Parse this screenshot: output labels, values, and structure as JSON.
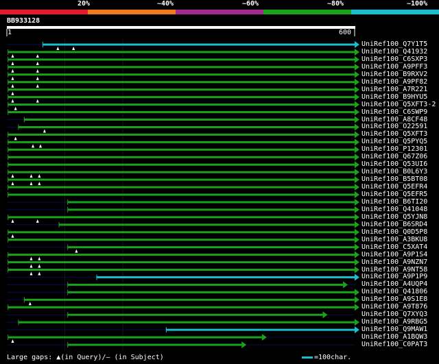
{
  "scale": {
    "segments": [
      {
        "label": "20%",
        "color": "#e8192a"
      },
      {
        "label": "~40%",
        "color": "#f07a1e"
      },
      {
        "label": "~60%",
        "color": "#a12b8e"
      },
      {
        "label": "~80%",
        "color": "#1aa31a"
      },
      {
        "label": "~100%",
        "color": "#19bfcf"
      }
    ]
  },
  "query": {
    "id": "BB933128",
    "start": "1",
    "end": "600",
    "length": 600
  },
  "legend": {
    "gaps": "Large gaps: ▲(in Query)/– (in Subject)",
    "scale": "=100char."
  },
  "colors": {
    "green": "#1aa31a",
    "cyan": "#19bfcf",
    "dim": "#0a0a50",
    "background": "#000000"
  },
  "hits": [
    {
      "id": "UniRef100_Q7Y1T5",
      "color": "cyan",
      "start": 62,
      "end": 600,
      "marks": [
        88,
        115
      ]
    },
    {
      "id": "UniRef100_Q41932",
      "color": "green",
      "start": 2,
      "end": 600,
      "marks": [
        10,
        53
      ]
    },
    {
      "id": "UniRef100_C6SXP3",
      "color": "green",
      "start": 2,
      "end": 600,
      "marks": [
        10,
        53
      ]
    },
    {
      "id": "UniRef100_A9PFF3",
      "color": "green",
      "start": 2,
      "end": 600,
      "marks": [
        10,
        53
      ]
    },
    {
      "id": "UniRef100_B9RXV2",
      "color": "green",
      "start": 2,
      "end": 600,
      "marks": [
        10,
        53
      ]
    },
    {
      "id": "UniRef100_A9PF82",
      "color": "green",
      "start": 2,
      "end": 600,
      "marks": [
        10,
        53
      ]
    },
    {
      "id": "UniRef100_A7R221",
      "color": "green",
      "start": 2,
      "end": 600,
      "marks": [
        10
      ]
    },
    {
      "id": "UniRef100_B9HYU5",
      "color": "green",
      "start": 2,
      "end": 600,
      "marks": [
        10,
        53
      ]
    },
    {
      "id": "UniRef100_Q5XFT3-2",
      "color": "green",
      "start": 2,
      "end": 600,
      "marks": [
        15
      ]
    },
    {
      "id": "UniRef100_C6SWP9",
      "color": "green",
      "start": 2,
      "end": 600,
      "marks": []
    },
    {
      "id": "UniRef100_A8CF48",
      "color": "green",
      "start": 30,
      "end": 600,
      "marks": []
    },
    {
      "id": "UniRef100_O22591",
      "color": "green",
      "start": 20,
      "end": 600,
      "marks": [
        65
      ]
    },
    {
      "id": "UniRef100_Q5XFT3",
      "color": "green",
      "start": 2,
      "end": 600,
      "marks": [
        15
      ]
    },
    {
      "id": "UniRef100_Q5PYQ5",
      "color": "green",
      "start": 2,
      "end": 600,
      "marks": [
        45,
        58
      ]
    },
    {
      "id": "UniRef100_P12301",
      "color": "green",
      "start": 2,
      "end": 600,
      "marks": []
    },
    {
      "id": "UniRef100_Q67Z06",
      "color": "green",
      "start": 2,
      "end": 600,
      "marks": []
    },
    {
      "id": "UniRef100_Q53UI6",
      "color": "green",
      "start": 2,
      "end": 600,
      "marks": []
    },
    {
      "id": "UniRef100_B0L6Y3",
      "color": "green",
      "start": 2,
      "end": 600,
      "marks": [
        10,
        42,
        56
      ]
    },
    {
      "id": "UniRef100_B5BT08",
      "color": "green",
      "start": 2,
      "end": 600,
      "marks": [
        10,
        42,
        56
      ]
    },
    {
      "id": "UniRef100_Q5EFR4",
      "color": "green",
      "start": 2,
      "end": 600,
      "marks": []
    },
    {
      "id": "UniRef100_Q5EFR5",
      "color": "green",
      "start": 2,
      "end": 600,
      "marks": []
    },
    {
      "id": "UniRef100_B6TI20",
      "color": "green",
      "start": 105,
      "end": 600,
      "marks": []
    },
    {
      "id": "UniRef100_Q41048",
      "color": "green",
      "start": 105,
      "end": 600,
      "marks": []
    },
    {
      "id": "UniRef100_Q5YJN8",
      "color": "green",
      "start": 2,
      "end": 600,
      "marks": [
        10,
        53
      ]
    },
    {
      "id": "UniRef100_B6SRD4",
      "color": "green",
      "start": 90,
      "end": 600,
      "marks": []
    },
    {
      "id": "UniRef100_Q0D5P8",
      "color": "green",
      "start": 2,
      "end": 600,
      "marks": [
        10
      ]
    },
    {
      "id": "UniRef100_A3BKU8",
      "color": "green",
      "start": 2,
      "end": 600,
      "marks": []
    },
    {
      "id": "UniRef100_C5XAT4",
      "color": "green",
      "start": 105,
      "end": 600,
      "marks": [
        120
      ]
    },
    {
      "id": "UniRef100_A9P1S4",
      "color": "green",
      "start": 2,
      "end": 600,
      "marks": [
        42,
        56
      ]
    },
    {
      "id": "UniRef100_A9NZN7",
      "color": "green",
      "start": 2,
      "end": 600,
      "marks": [
        42,
        56
      ]
    },
    {
      "id": "UniRef100_A9NT58",
      "color": "green",
      "start": 2,
      "end": 600,
      "marks": [
        42,
        56
      ]
    },
    {
      "id": "UniRef100_A9P1P9",
      "color": "cyan",
      "start": 155,
      "end": 600,
      "marks": []
    },
    {
      "id": "UniRef100_A4UQP4",
      "color": "green",
      "start": 105,
      "end": 580,
      "marks": []
    },
    {
      "id": "UniRef100_Q41806",
      "color": "green",
      "start": 105,
      "end": 600,
      "marks": []
    },
    {
      "id": "UniRef100_A9S1E8",
      "color": "green",
      "start": 30,
      "end": 600,
      "marks": [
        40
      ]
    },
    {
      "id": "UniRef100_A9T876",
      "color": "green",
      "start": 2,
      "end": 600,
      "marks": []
    },
    {
      "id": "UniRef100_Q7XYQ3",
      "color": "green",
      "start": 105,
      "end": 545,
      "marks": []
    },
    {
      "id": "UniRef100_A9RBG5",
      "color": "green",
      "start": 20,
      "end": 600,
      "marks": []
    },
    {
      "id": "UniRef100_Q9MAW1",
      "color": "cyan",
      "start": 275,
      "end": 600,
      "marks": []
    },
    {
      "id": "UniRef100_A1BQW3",
      "color": "green",
      "start": 2,
      "end": 440,
      "marks": [
        10
      ]
    },
    {
      "id": "UniRef100_C0PAT3",
      "color": "green",
      "start": 105,
      "end": 405,
      "marks": []
    }
  ]
}
